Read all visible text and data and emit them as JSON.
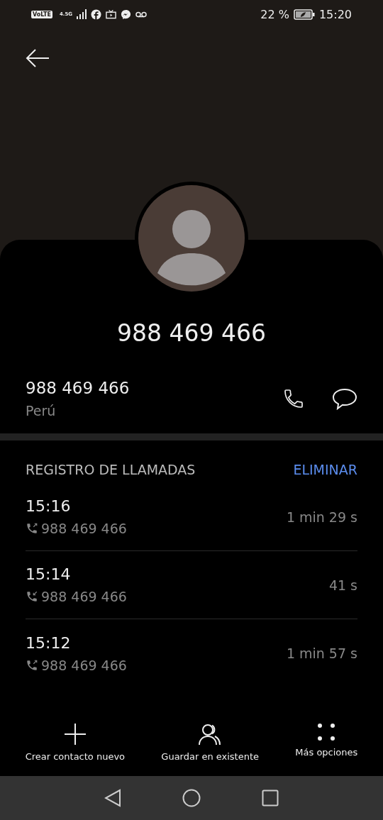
{
  "status_bar": {
    "volte": "VoLTE",
    "network": "4.5G",
    "battery": "22 %",
    "time": "15:20"
  },
  "contact": {
    "title": "988 469 466",
    "number": "988 469 466",
    "country": "Perú"
  },
  "call_log": {
    "heading": "REGISTRO DE LLAMADAS",
    "action": "ELIMINAR",
    "calls": [
      {
        "time": "15:16",
        "kind": "outgoing",
        "number": "988 469 466",
        "duration": "1 min 29 s"
      },
      {
        "time": "15:14",
        "kind": "incoming",
        "number": "988 469 466",
        "duration": "41 s"
      },
      {
        "time": "15:12",
        "kind": "outgoing",
        "number": "988 469 466",
        "duration": "1 min 57 s"
      }
    ]
  },
  "actions": [
    {
      "kind": "add",
      "label": "Crear contacto nuevo"
    },
    {
      "kind": "existing",
      "label": "Guardar en existente"
    },
    {
      "kind": "more",
      "label": "Más opciones"
    }
  ]
}
